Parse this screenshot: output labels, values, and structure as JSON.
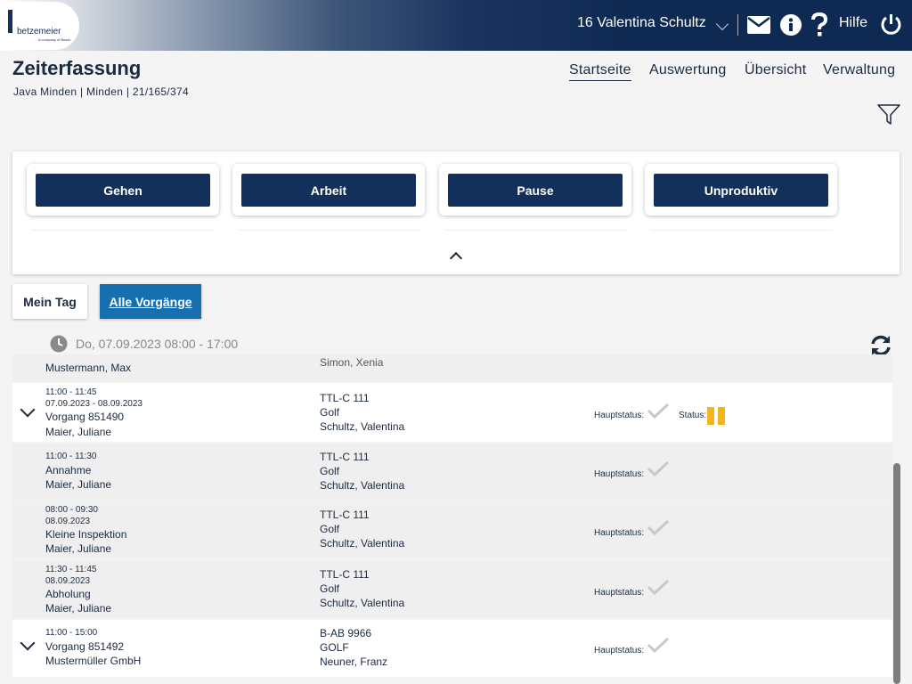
{
  "header": {
    "logo_text": "betzemeier",
    "logo_sub": "A company of Bosch",
    "user": "16 Valentina Schultz",
    "help": "Hilfe"
  },
  "page": {
    "title": "Zeiterfassung",
    "subtitle": "Java Minden | Minden | 21/165/374"
  },
  "nav": [
    "Startseite",
    "Auswertung",
    "Übersicht",
    "Verwaltung"
  ],
  "actions": [
    "Gehen",
    "Arbeit",
    "Pause",
    "Unproduktiv"
  ],
  "tabs": {
    "my_day": "Mein Tag",
    "all": "Alle Vorgänge"
  },
  "date_range": "Do, 07.09.2023 08:00 - 17:00",
  "rows": [
    {
      "name": "Mustermann, Max",
      "person": "Simon, Xenia"
    },
    {
      "time": "11:00 - 11:45",
      "dates": "07.09.2023 - 08.09.2023",
      "title": "Vorgang 851490",
      "name": "Maier, Juliane",
      "plate": "TTL-C 111",
      "model": "Golf",
      "person": "Schultz, Valentina",
      "hauptstatus": "Hauptstatus:",
      "status": "Status:"
    },
    {
      "time": "11:00 - 11:30",
      "title": "Annahme",
      "name": "Maier, Juliane",
      "plate": "TTL-C 111",
      "model": "Golf",
      "person": "Schultz, Valentina",
      "hauptstatus": "Hauptstatus:"
    },
    {
      "time": "08:00 - 09:30",
      "dates": "08.09.2023",
      "title": "Kleine Inspektion",
      "name": "Maier, Juliane",
      "plate": "TTL-C 111",
      "model": "Golf",
      "person": "Schultz, Valentina",
      "hauptstatus": "Hauptstatus:"
    },
    {
      "time": "11:30 - 11:45",
      "dates": "08.09.2023",
      "title": "Abholung",
      "name": "Maier, Juliane",
      "plate": "TTL-C 111",
      "model": "Golf",
      "person": "Schultz, Valentina",
      "hauptstatus": "Hauptstatus:"
    },
    {
      "time": "11:00 - 15:00",
      "title": "Vorgang 851492",
      "name": "Mustermüller GmbH",
      "plate": "B-AB 9966",
      "model": "GOLF",
      "person": "Neuner, Franz",
      "hauptstatus": "Hauptstatus:"
    }
  ],
  "colors": {
    "primary": "#12305a",
    "accent": "#1670b0",
    "status_pause": "#f2b51d"
  }
}
